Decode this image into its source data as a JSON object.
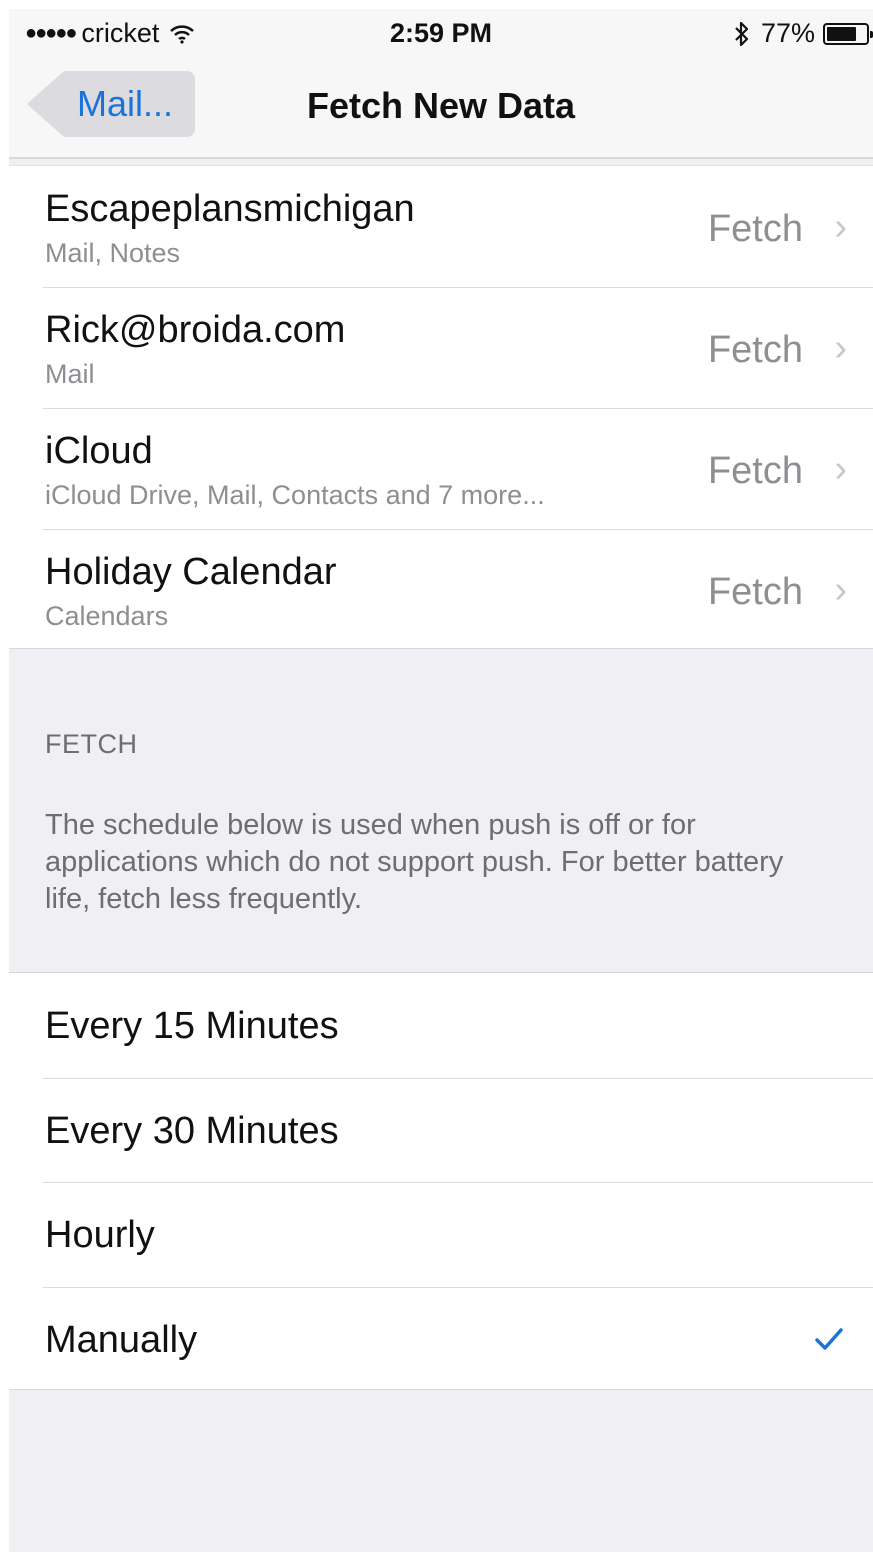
{
  "status_bar": {
    "signal": "●●●●●",
    "carrier": "cricket",
    "wifi_icon": "wifi-icon",
    "time": "2:59 PM",
    "bluetooth_icon": "bluetooth-icon",
    "battery_text": "77%",
    "battery_level": 0.77
  },
  "nav": {
    "back_label": "Mail...",
    "title": "Fetch New Data"
  },
  "accounts": [
    {
      "name": "Escapeplansmichigan",
      "sub": "Mail, Notes",
      "value": "Fetch"
    },
    {
      "name": "Rick@broida.com",
      "sub": "Mail",
      "value": "Fetch"
    },
    {
      "name": "iCloud",
      "sub": "iCloud Drive, Mail, Contacts and 7 more...",
      "value": "Fetch"
    },
    {
      "name": "Holiday Calendar",
      "sub": "Calendars",
      "value": "Fetch"
    }
  ],
  "fetch_section": {
    "header": "FETCH",
    "description": "The schedule below is used when push is off or for applications which do not support push. For better battery life, fetch less frequently."
  },
  "schedule_options": [
    {
      "label": "Every 15 Minutes",
      "selected": false
    },
    {
      "label": "Every 30 Minutes",
      "selected": false
    },
    {
      "label": "Hourly",
      "selected": false
    },
    {
      "label": "Manually",
      "selected": true
    }
  ],
  "colors": {
    "accent": "#1a73d9",
    "grouped_background": "#efeff4",
    "secondary_text": "#8e8e93"
  }
}
